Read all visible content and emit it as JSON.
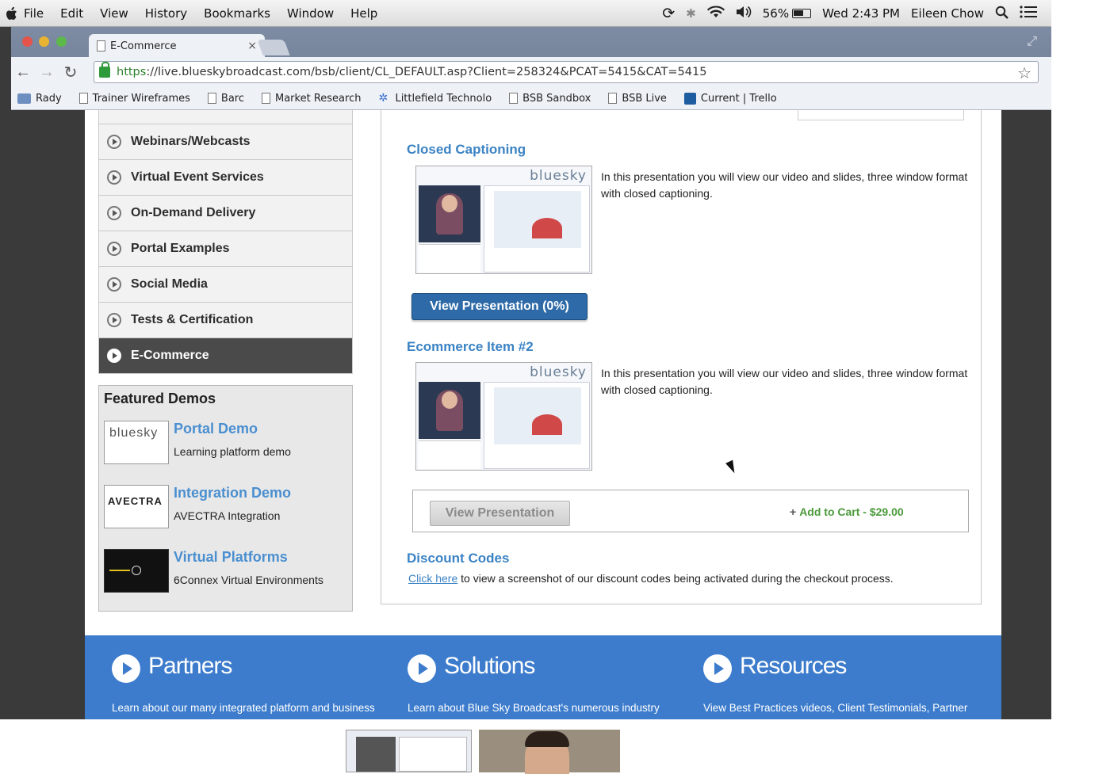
{
  "menubar": {
    "items": [
      "File",
      "Edit",
      "View",
      "History",
      "Bookmarks",
      "Window",
      "Help"
    ],
    "battery": "56%",
    "clock": "Wed 2:43 PM",
    "user": "Eileen Chow"
  },
  "browser": {
    "tab_title": "E-Commerce",
    "tab_close": "×",
    "url_scheme": "https",
    "url_rest": "://live.blueskybroadcast.com/bsb/client/CL_DEFAULT.asp?Client=258324&PCAT=5415&CAT=5415",
    "bookmarks": [
      "Rady",
      "Trainer Wireframes",
      "Barc",
      "Market Research",
      "Littlefield Technolo",
      "BSB Sandbox",
      "BSB Live",
      "Current | Trello"
    ]
  },
  "sidebar": {
    "items": [
      {
        "label": "Webinars/Webcasts"
      },
      {
        "label": "Virtual Event Services"
      },
      {
        "label": "On-Demand Delivery"
      },
      {
        "label": "Portal Examples"
      },
      {
        "label": "Social Media"
      },
      {
        "label": "Tests & Certification"
      },
      {
        "label": "E-Commerce"
      }
    ]
  },
  "featured": {
    "heading": "Featured Demos",
    "demos": [
      {
        "title": "Portal Demo",
        "desc": "Learning platform demo",
        "thumb_text": "bluesky"
      },
      {
        "title": "Integration Demo",
        "desc": "AVECTRA Integration",
        "thumb_text": "AVECTRA"
      },
      {
        "title": "Virtual Platforms",
        "desc": "6Connex Virtual Environments",
        "thumb_text": ""
      }
    ]
  },
  "main": {
    "items": [
      {
        "title": "Closed Captioning",
        "logo": "bluesky",
        "desc": "In this presentation you will view our video and slides, three window format with closed captioning.",
        "button": "View Presentation  (0%)"
      },
      {
        "title": "Ecommerce Item #2",
        "logo": "bluesky",
        "desc": "In this presentation you will view our video and slides, three window format with closed captioning.",
        "button": "View Presentation",
        "add_to_cart": "Add to Cart - $29.00"
      }
    ],
    "discount": {
      "title": "Discount Codes",
      "link": "Click here",
      "text": " to view a screenshot of our discount codes being activated during the checkout process."
    }
  },
  "footer": {
    "columns": [
      {
        "title": "Partners",
        "desc": "Learn about our many integrated platform and business"
      },
      {
        "title": "Solutions",
        "desc": "Learn about Blue Sky Broadcast's numerous industry"
      },
      {
        "title": "Resources",
        "desc": "View Best Practices videos, Client Testimonials, Partner"
      }
    ]
  },
  "colors": {
    "accent_blue": "#3b83c4",
    "button_blue": "#2d6aa7",
    "footer_blue": "#3d7ccc",
    "cart_green": "#4a9a3a",
    "active_nav": "#4a4a4a"
  }
}
